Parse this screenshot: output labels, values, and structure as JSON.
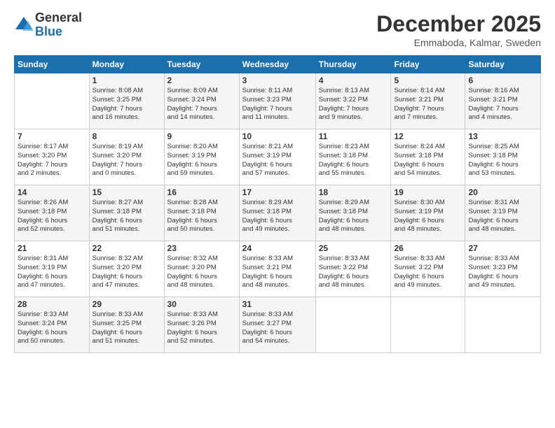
{
  "header": {
    "logo_general": "General",
    "logo_blue": "Blue",
    "month_title": "December 2025",
    "location": "Emmaboda, Kalmar, Sweden"
  },
  "weekdays": [
    "Sunday",
    "Monday",
    "Tuesday",
    "Wednesday",
    "Thursday",
    "Friday",
    "Saturday"
  ],
  "weeks": [
    [
      {
        "day": "",
        "info": ""
      },
      {
        "day": "1",
        "info": "Sunrise: 8:08 AM\nSunset: 3:25 PM\nDaylight: 7 hours\nand 16 minutes."
      },
      {
        "day": "2",
        "info": "Sunrise: 8:09 AM\nSunset: 3:24 PM\nDaylight: 7 hours\nand 14 minutes."
      },
      {
        "day": "3",
        "info": "Sunrise: 8:11 AM\nSunset: 3:23 PM\nDaylight: 7 hours\nand 11 minutes."
      },
      {
        "day": "4",
        "info": "Sunrise: 8:13 AM\nSunset: 3:22 PM\nDaylight: 7 hours\nand 9 minutes."
      },
      {
        "day": "5",
        "info": "Sunrise: 8:14 AM\nSunset: 3:21 PM\nDaylight: 7 hours\nand 7 minutes."
      },
      {
        "day": "6",
        "info": "Sunrise: 8:16 AM\nSunset: 3:21 PM\nDaylight: 7 hours\nand 4 minutes."
      }
    ],
    [
      {
        "day": "7",
        "info": "Sunrise: 8:17 AM\nSunset: 3:20 PM\nDaylight: 7 hours\nand 2 minutes."
      },
      {
        "day": "8",
        "info": "Sunrise: 8:19 AM\nSunset: 3:20 PM\nDaylight: 7 hours\nand 0 minutes."
      },
      {
        "day": "9",
        "info": "Sunrise: 8:20 AM\nSunset: 3:19 PM\nDaylight: 6 hours\nand 59 minutes."
      },
      {
        "day": "10",
        "info": "Sunrise: 8:21 AM\nSunset: 3:19 PM\nDaylight: 6 hours\nand 57 minutes."
      },
      {
        "day": "11",
        "info": "Sunrise: 8:23 AM\nSunset: 3:18 PM\nDaylight: 6 hours\nand 55 minutes."
      },
      {
        "day": "12",
        "info": "Sunrise: 8:24 AM\nSunset: 3:18 PM\nDaylight: 6 hours\nand 54 minutes."
      },
      {
        "day": "13",
        "info": "Sunrise: 8:25 AM\nSunset: 3:18 PM\nDaylight: 6 hours\nand 53 minutes."
      }
    ],
    [
      {
        "day": "14",
        "info": "Sunrise: 8:26 AM\nSunset: 3:18 PM\nDaylight: 6 hours\nand 52 minutes."
      },
      {
        "day": "15",
        "info": "Sunrise: 8:27 AM\nSunset: 3:18 PM\nDaylight: 6 hours\nand 51 minutes."
      },
      {
        "day": "16",
        "info": "Sunrise: 8:28 AM\nSunset: 3:18 PM\nDaylight: 6 hours\nand 50 minutes."
      },
      {
        "day": "17",
        "info": "Sunrise: 8:29 AM\nSunset: 3:18 PM\nDaylight: 6 hours\nand 49 minutes."
      },
      {
        "day": "18",
        "info": "Sunrise: 8:29 AM\nSunset: 3:18 PM\nDaylight: 6 hours\nand 48 minutes."
      },
      {
        "day": "19",
        "info": "Sunrise: 8:30 AM\nSunset: 3:19 PM\nDaylight: 6 hours\nand 48 minutes."
      },
      {
        "day": "20",
        "info": "Sunrise: 8:31 AM\nSunset: 3:19 PM\nDaylight: 6 hours\nand 48 minutes."
      }
    ],
    [
      {
        "day": "21",
        "info": "Sunrise: 8:31 AM\nSunset: 3:19 PM\nDaylight: 6 hours\nand 47 minutes."
      },
      {
        "day": "22",
        "info": "Sunrise: 8:32 AM\nSunset: 3:20 PM\nDaylight: 6 hours\nand 47 minutes."
      },
      {
        "day": "23",
        "info": "Sunrise: 8:32 AM\nSunset: 3:20 PM\nDaylight: 6 hours\nand 48 minutes."
      },
      {
        "day": "24",
        "info": "Sunrise: 8:33 AM\nSunset: 3:21 PM\nDaylight: 6 hours\nand 48 minutes."
      },
      {
        "day": "25",
        "info": "Sunrise: 8:33 AM\nSunset: 3:22 PM\nDaylight: 6 hours\nand 48 minutes."
      },
      {
        "day": "26",
        "info": "Sunrise: 8:33 AM\nSunset: 3:22 PM\nDaylight: 6 hours\nand 49 minutes."
      },
      {
        "day": "27",
        "info": "Sunrise: 8:33 AM\nSunset: 3:23 PM\nDaylight: 6 hours\nand 49 minutes."
      }
    ],
    [
      {
        "day": "28",
        "info": "Sunrise: 8:33 AM\nSunset: 3:24 PM\nDaylight: 6 hours\nand 50 minutes."
      },
      {
        "day": "29",
        "info": "Sunrise: 8:33 AM\nSunset: 3:25 PM\nDaylight: 6 hours\nand 51 minutes."
      },
      {
        "day": "30",
        "info": "Sunrise: 8:33 AM\nSunset: 3:26 PM\nDaylight: 6 hours\nand 52 minutes."
      },
      {
        "day": "31",
        "info": "Sunrise: 8:33 AM\nSunset: 3:27 PM\nDaylight: 6 hours\nand 54 minutes."
      },
      {
        "day": "",
        "info": ""
      },
      {
        "day": "",
        "info": ""
      },
      {
        "day": "",
        "info": ""
      }
    ]
  ]
}
